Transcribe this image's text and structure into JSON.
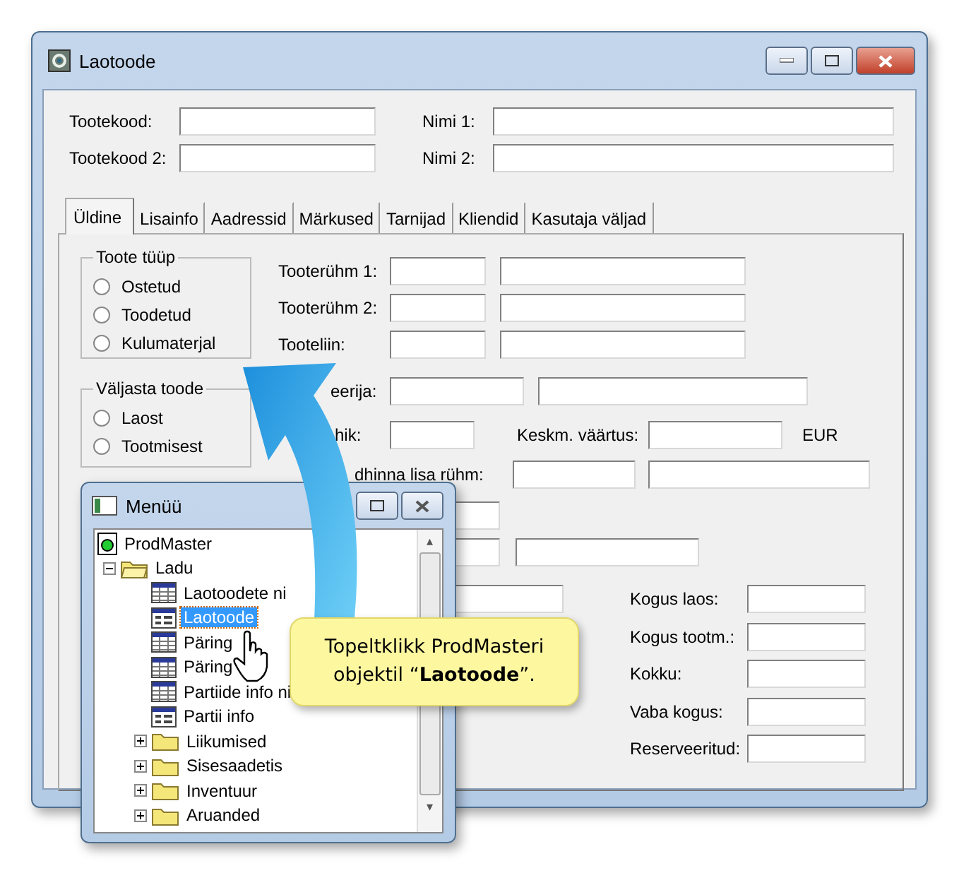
{
  "window": {
    "title": "Laotoode"
  },
  "header_fields": [
    {
      "label": "Tootekood:"
    },
    {
      "label": "Nimi 1:"
    },
    {
      "label": "Tootekood 2:"
    },
    {
      "label": "Nimi 2:"
    }
  ],
  "tabs": [
    {
      "label": "Üldine",
      "selected": true
    },
    {
      "label": "Lisainfo",
      "selected": false
    },
    {
      "label": "Aadressid",
      "selected": false
    },
    {
      "label": "Märkused",
      "selected": false
    },
    {
      "label": "Tarnijad",
      "selected": false
    },
    {
      "label": "Kliendid",
      "selected": false
    },
    {
      "label": "Kasutaja väljad",
      "selected": false
    }
  ],
  "product_type": {
    "title": "Toote tüüp",
    "options": [
      {
        "label": "Ostetud",
        "selected": false
      },
      {
        "label": "Toodetud",
        "selected": false
      },
      {
        "label": "Kulumaterjal",
        "selected": false
      }
    ]
  },
  "issue_from": {
    "title": "Väljasta toode",
    "options": [
      {
        "label": "Laost",
        "selected": false
      },
      {
        "label": "Tootmisest",
        "selected": false
      }
    ]
  },
  "group_fields": [
    {
      "label": "Tooterühm 1:"
    },
    {
      "label": "Tooterühm 2:"
    },
    {
      "label": "Tooteliin:"
    }
  ],
  "partial_labels": [
    "eerija:",
    "hik:",
    "dhinna lisa rühm:"
  ],
  "average_value": {
    "label": "Keskm. väärtus:",
    "unit": "EUR"
  },
  "quantities": [
    {
      "label": "Kogus laos:"
    },
    {
      "label": "Kogus tootm.:"
    },
    {
      "label": "Kokku:"
    },
    {
      "label": "Vaba kogus:"
    },
    {
      "label": "Reserveeritud:"
    }
  ],
  "menu_window": {
    "title": "Menüü",
    "scroll_arrows": [
      "▴",
      "▾"
    ],
    "tree": [
      {
        "label": "ProdMaster",
        "kind": "root",
        "selected": false,
        "children": [
          {
            "label": "Ladu",
            "kind": "folder",
            "selected": false,
            "expanded": true,
            "children": [
              {
                "label": "Laotoodete ni",
                "kind": "list",
                "selected": false
              },
              {
                "label": "Laotoode",
                "kind": "form",
                "selected": true
              },
              {
                "label": "Päring",
                "kind": "list",
                "selected": false
              },
              {
                "label": "Päring",
                "kind": "list",
                "selected": false
              },
              {
                "label": "Partiide info ni",
                "kind": "list",
                "selected": false
              },
              {
                "label": "Partii info",
                "kind": "form",
                "selected": false
              },
              {
                "label": "Liikumised",
                "kind": "folder",
                "selected": false,
                "expanded": false
              },
              {
                "label": "Sisesaadetis",
                "kind": "folder",
                "selected": false,
                "expanded": false
              },
              {
                "label": "Inventuur",
                "kind": "folder",
                "selected": false,
                "expanded": false
              },
              {
                "label": "Aruanded",
                "kind": "folder",
                "selected": false,
                "expanded": false
              }
            ]
          }
        ]
      }
    ]
  },
  "callout": {
    "text": "Topeltklikk ProdMasteri objektil “**Laotoode**”."
  }
}
